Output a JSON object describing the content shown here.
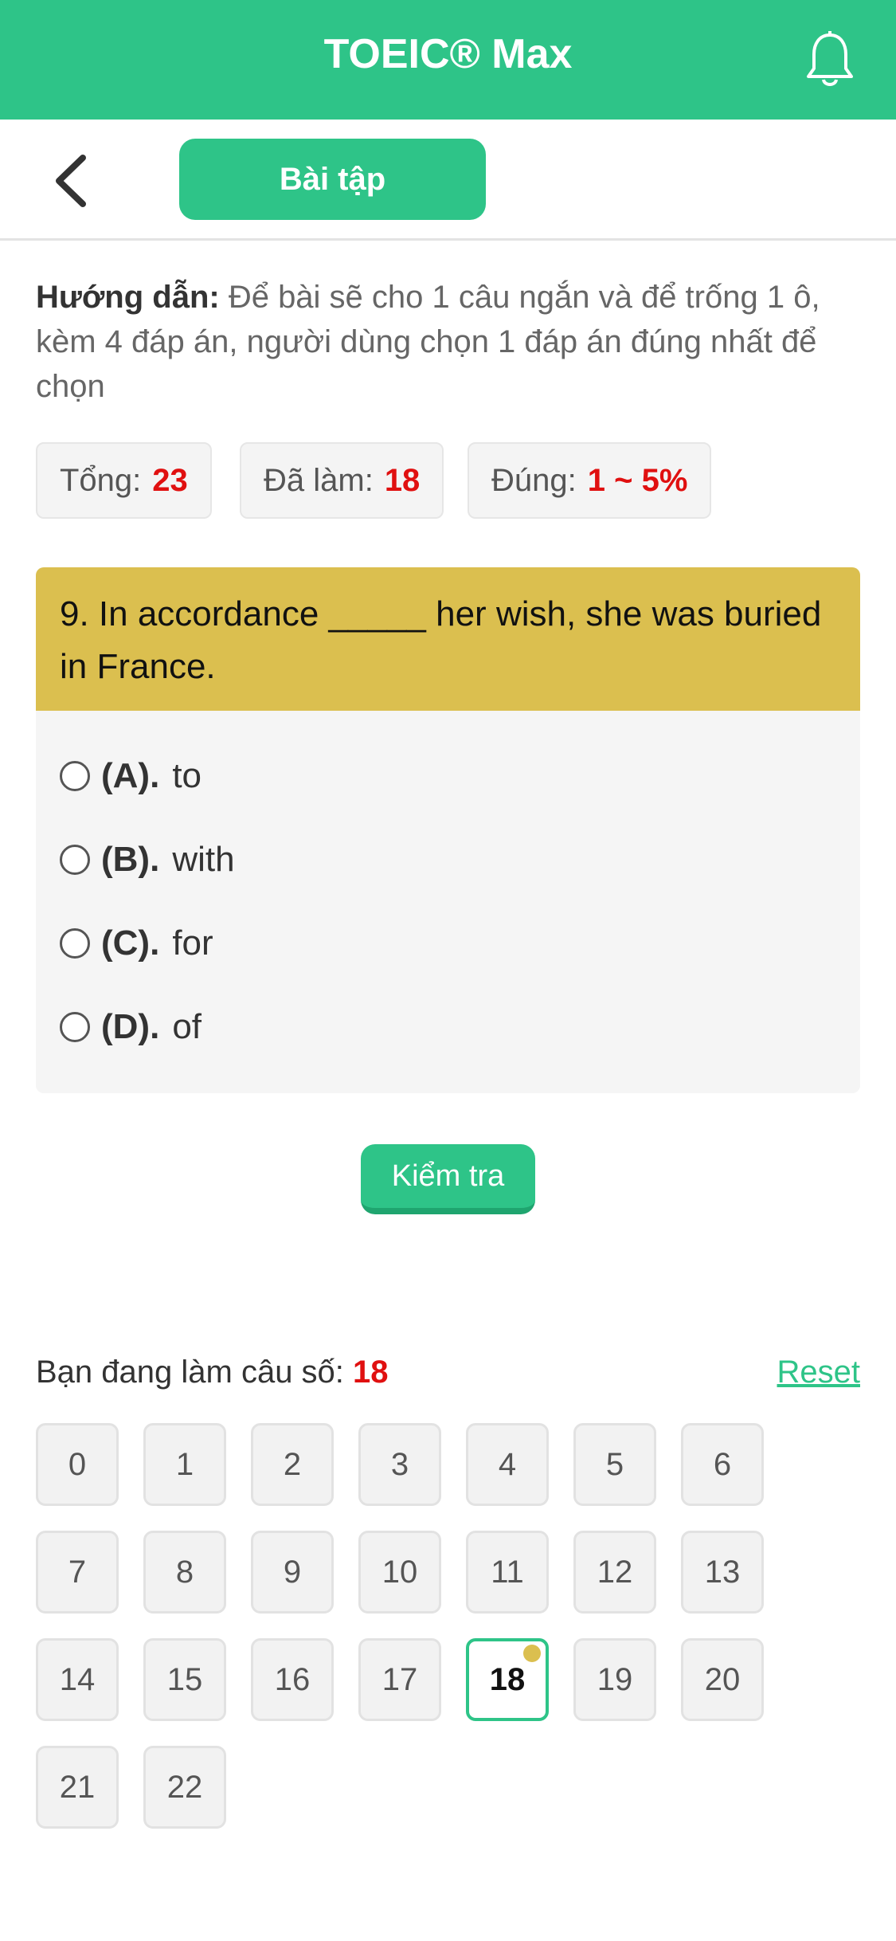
{
  "header": {
    "title": "TOEIC® Max",
    "bell_icon": "bell-icon"
  },
  "subbar": {
    "back_icon": "chevron-left-icon",
    "tab_label": "Bài tập"
  },
  "instructions": {
    "label": "Hướng dẫn:",
    "text": " Để bài sẽ cho 1 câu ngắn và để trống 1 ô, kèm 4 đáp án, người dùng chọn 1 đáp án đúng nhất để chọn"
  },
  "stats": {
    "total_label": "Tổng:",
    "total_value": "23",
    "done_label": "Đã làm:",
    "done_value": "18",
    "correct_label": "Đúng:",
    "correct_value": "1 ~ 5%"
  },
  "question": {
    "text": "9. In accordance _____ her wish, she was buried in France.",
    "options": [
      {
        "label": "(A).",
        "text": "to"
      },
      {
        "label": "(B).",
        "text": "with"
      },
      {
        "label": "(C).",
        "text": "for"
      },
      {
        "label": "(D).",
        "text": "of"
      }
    ]
  },
  "check_button": "Kiểm tra",
  "progress": {
    "label": "Bạn đang làm câu số:",
    "current": "18",
    "reset_label": "Reset"
  },
  "question_numbers": [
    "0",
    "1",
    "2",
    "3",
    "4",
    "5",
    "6",
    "7",
    "8",
    "9",
    "10",
    "11",
    "12",
    "13",
    "14",
    "15",
    "16",
    "17",
    "18",
    "19",
    "20",
    "21",
    "22"
  ],
  "colors": {
    "brand": "#2ec488",
    "question_bg": "#dbbf4f",
    "highlight": "#e01010"
  }
}
